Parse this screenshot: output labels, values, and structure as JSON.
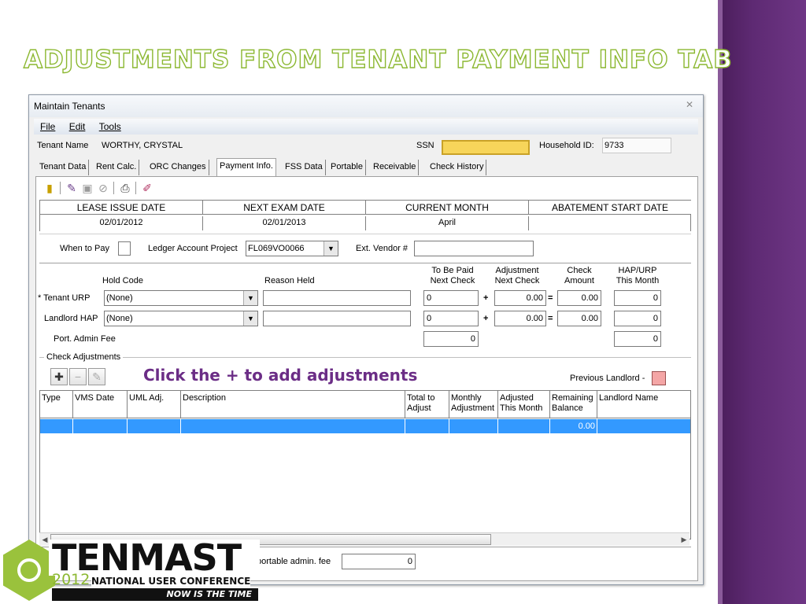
{
  "slide": {
    "title": "Adjustments from Tenant Payment Info Tab",
    "note": "Click the + to add adjustments"
  },
  "window": {
    "title": "Maintain Tenants",
    "menu": [
      "File",
      "Edit",
      "Tools"
    ]
  },
  "tenant": {
    "name_label": "Tenant Name",
    "name": "WORTHY, CRYSTAL",
    "ssn_label": "SSN",
    "household_label": "Household ID:",
    "household_id": "9733"
  },
  "tabs": [
    "Tenant Data",
    "Rent Calc.",
    "ORC Changes",
    "Payment Info.",
    "FSS Data",
    "Portable",
    "Receivable",
    "Check History"
  ],
  "active_tab": "Payment Info.",
  "dates": {
    "lease_issue_label": "LEASE ISSUE DATE",
    "lease_issue": "02/01/2012",
    "next_exam_label": "NEXT EXAM DATE",
    "next_exam": "02/01/2013",
    "current_month_label": "CURRENT MONTH",
    "current_month": "April",
    "abatement_label": "ABATEMENT START DATE",
    "abatement": ""
  },
  "payment": {
    "when_to_pay_label": "When to Pay",
    "ledger_label": "Ledger Account Project",
    "ledger_value": "FL069VO0066",
    "vendor_label": "Ext. Vendor #",
    "vendor_value": ""
  },
  "columns": {
    "hold_code": "Hold Code",
    "reason_held": "Reason Held",
    "to_be_paid_1": "To Be Paid",
    "to_be_paid_2": "Next Check",
    "adjustment_1": "Adjustment",
    "adjustment_2": "Next Check",
    "check_1": "Check",
    "check_2": "Amount",
    "hap_1": "HAP/URP",
    "hap_2": "This Month"
  },
  "rows": {
    "tenant_urp": {
      "label": "* Tenant URP",
      "hold": "(None)",
      "reason": "",
      "to_be_paid": "0",
      "adjustment": "0.00",
      "check": "0.00",
      "hap": "0"
    },
    "landlord_hap": {
      "label": "Landlord HAP",
      "hold": "(None)",
      "reason": "",
      "to_be_paid": "0",
      "adjustment": "0.00",
      "check": "0.00",
      "hap": "0"
    },
    "port_admin": {
      "label": "Port. Admin Fee",
      "to_be_paid": "0",
      "hap": "0"
    }
  },
  "operators": {
    "plus": "+",
    "equals": "="
  },
  "check_adjustments": {
    "group_label": "Check Adjustments",
    "prev_landlord_label": "Previous Landlord -",
    "prev_landlord_color": "#f4a6a6",
    "grid_headers": [
      "Type",
      "VMS Date",
      "UML Adj.",
      "Description",
      "Total to\nAdjust",
      "Monthly\nAdjustment",
      "Adjusted\nThis Month",
      "Remaining\nBalance",
      "Landlord Name"
    ],
    "selected_row_remaining": "0.00",
    "selection_color": "#3399ff"
  },
  "bottom": {
    "portable_label": "portable admin. fee",
    "portable_value": "0"
  },
  "logo": {
    "brand": "TENMAST",
    "year": "2012",
    "conference": "NATIONAL USER CONFERENCE",
    "tagline": "NOW IS THE TIME",
    "accent": "#8cb832"
  }
}
